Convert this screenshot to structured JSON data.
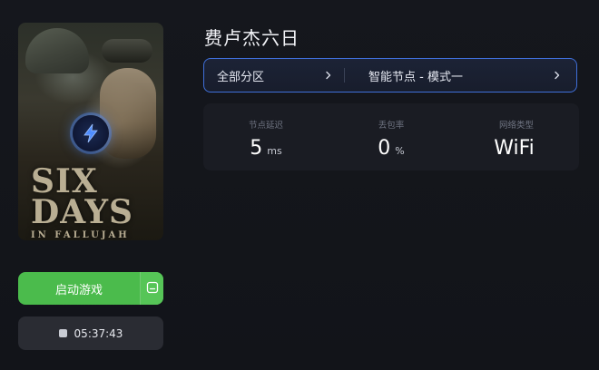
{
  "game": {
    "title": "费卢杰六日",
    "cover": {
      "line1": "SIX",
      "line2": "DAYS",
      "line3": "IN FALLUJAH",
      "badge_icon": "lightning-bolt-icon"
    }
  },
  "selector": {
    "region_label": "全部分区",
    "node_label": "智能节点 - 模式一",
    "chevron_icon": "chevron-right-icon"
  },
  "stats": [
    {
      "label": "节点延迟",
      "value": "5",
      "unit": "ms"
    },
    {
      "label": "丢包率",
      "value": "0",
      "unit": "%"
    },
    {
      "label": "网络类型",
      "value": "WiFi",
      "unit": ""
    }
  ],
  "launch": {
    "label": "启动游戏",
    "side_icon": "minimize-window-icon"
  },
  "timer": {
    "value": "05:37:43",
    "icon": "stop-icon"
  },
  "colors": {
    "accent_blue": "#3f6fd9",
    "launch_green": "#4bbb4c",
    "background": "#14161c"
  }
}
